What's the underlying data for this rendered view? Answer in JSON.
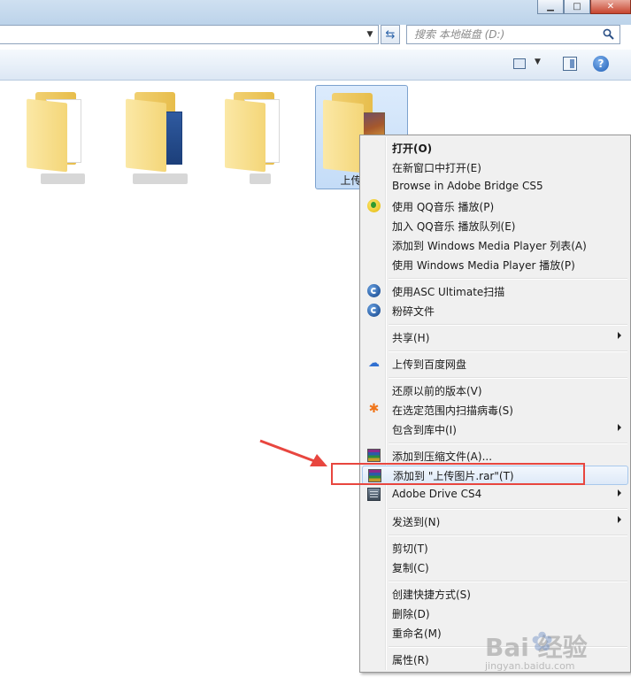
{
  "window": {
    "minimize_glyph": "▁",
    "maximize_glyph": "□",
    "close_glyph": "✕"
  },
  "address_bar": {
    "dropdown_glyph": "▼",
    "refresh_glyph": "⇆"
  },
  "search": {
    "placeholder": "搜索 本地磁盘 (D:)",
    "icon": "search-icon"
  },
  "command_bar": {
    "view_dropdown_glyph": "▼",
    "help_glyph": "?"
  },
  "folders": [
    {
      "label": "",
      "blurred": true
    },
    {
      "label": "",
      "blurred": true
    },
    {
      "label": "",
      "blurred": true
    },
    {
      "label": "上传",
      "selected": true
    }
  ],
  "context_menu": {
    "items": [
      {
        "label": "打开(O)",
        "bold": true
      },
      {
        "label": "在新窗口中打开(E)"
      },
      {
        "label": "Browse in Adobe Bridge CS5"
      },
      {
        "label": "使用 QQ音乐 播放(P)",
        "icon": "qq-music-icon"
      },
      {
        "label": "加入 QQ音乐 播放队列(E)"
      },
      {
        "label": "添加到 Windows Media Player 列表(A)"
      },
      {
        "label": "使用 Windows Media Player 播放(P)"
      },
      {
        "label": "使用ASC Ultimate扫描",
        "icon": "asc-icon"
      },
      {
        "label": "粉碎文件",
        "icon": "asc-icon"
      },
      {
        "label": "共享(H)",
        "submenu": true
      },
      {
        "label": "上传到百度网盘",
        "icon": "baidu-netdisk-icon"
      },
      {
        "label": "还原以前的版本(V)"
      },
      {
        "label": "在选定范围内扫描病毒(S)",
        "icon": "avast-icon"
      },
      {
        "label": "包含到库中(I)",
        "submenu": true
      },
      {
        "label": "添加到压缩文件(A)...",
        "icon": "winrar-icon"
      },
      {
        "label": "添加到 \"上传图片.rar\"(T)",
        "icon": "winrar-icon",
        "highlighted": true
      },
      {
        "label": "Adobe Drive CS4",
        "icon": "adobe-drive-icon",
        "submenu": true
      },
      {
        "label": "发送到(N)",
        "submenu": true
      },
      {
        "label": "剪切(T)"
      },
      {
        "label": "复制(C)"
      },
      {
        "label": "创建快捷方式(S)"
      },
      {
        "label": "删除(D)"
      },
      {
        "label": "重命名(M)"
      },
      {
        "label": "属性(R)"
      }
    ]
  },
  "annotation": {
    "color": "#e8463f"
  },
  "watermark": {
    "text": "Bai 经验",
    "sub": "jingyan.baidu.com"
  }
}
